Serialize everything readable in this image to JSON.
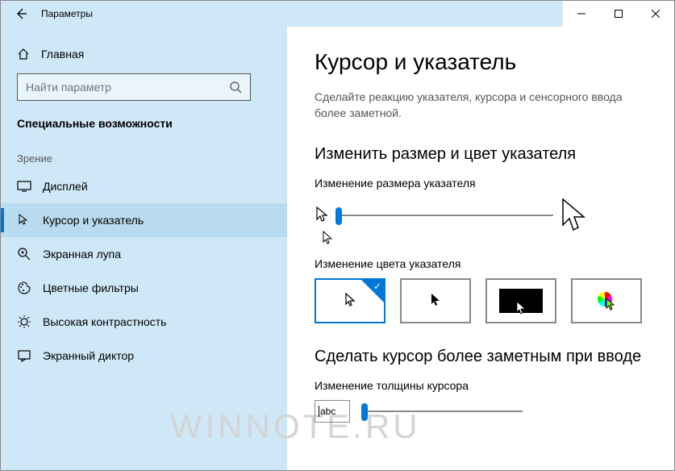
{
  "window": {
    "title": "Параметры"
  },
  "sidebar": {
    "home": "Главная",
    "search_placeholder": "Найти параметр",
    "category": "Специальные возможности",
    "group_vision": "Зрение",
    "items": [
      {
        "label": "Дисплей"
      },
      {
        "label": "Курсор и указатель"
      },
      {
        "label": "Экранная лупа"
      },
      {
        "label": "Цветные фильтры"
      },
      {
        "label": "Высокая контрастность"
      },
      {
        "label": "Экранный диктор"
      }
    ]
  },
  "page": {
    "title": "Курсор и указатель",
    "subtitle": "Сделайте реакцию указателя, курсора и сенсорного ввода более заметной.",
    "section_size_color": "Изменить размер и цвет указателя",
    "label_pointer_size": "Изменение размера указателя",
    "label_pointer_color": "Изменение цвета указателя",
    "section_cursor": "Сделать курсор более заметным при вводе",
    "label_cursor_thickness": "Изменение толщины курсора",
    "thickness_sample": "abc"
  },
  "watermark": "WINNOTE.RU"
}
